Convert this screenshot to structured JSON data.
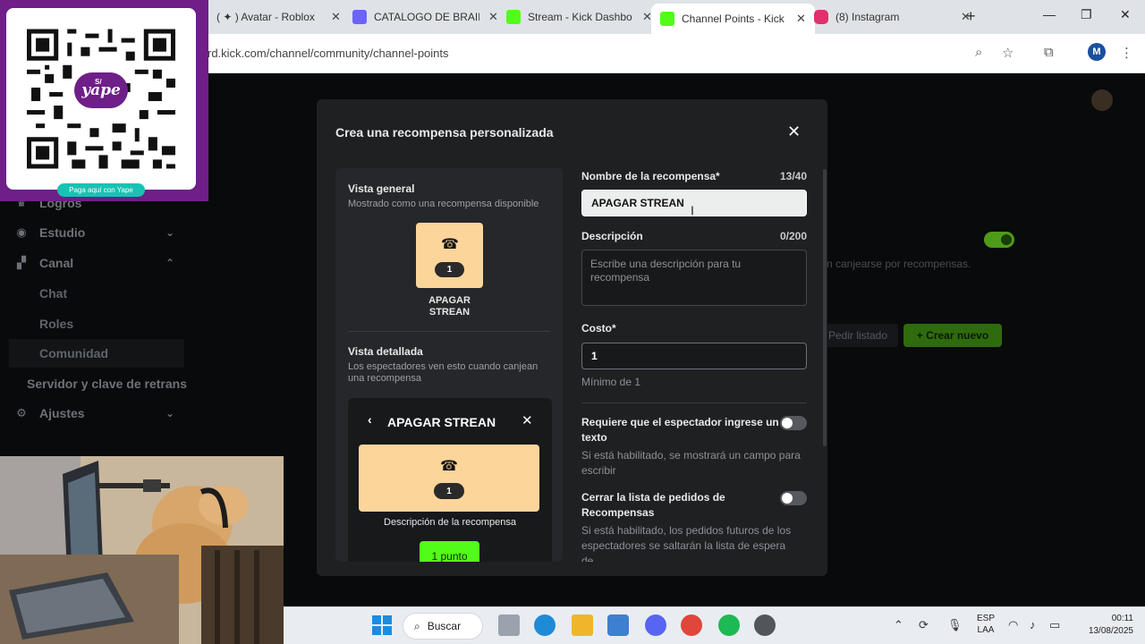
{
  "browser": {
    "tabs": [
      {
        "title": "( ✦ ) Avatar - Roblox",
        "color": "#dfe3e8",
        "favicon_color": "#dfe3e8"
      },
      {
        "title": "CATALOGO DE BRAIN",
        "favicon_color": "#6c63ff"
      },
      {
        "title": "Stream - Kick Dashbo",
        "favicon_color": "#53fc18"
      },
      {
        "title": "Channel Points - Kick",
        "favicon_color": "#53fc18",
        "active": true
      },
      {
        "title": "(8) Instagram",
        "favicon_color": "#e1306c"
      }
    ],
    "url": "rd.kick.com/channel/community/channel-points",
    "profile_initial": "M",
    "tab_close_glyph": "✕",
    "new_tab_glyph": "+"
  },
  "sidebar": {
    "items": [
      {
        "label": "Logros",
        "icon": "trophy-icon"
      },
      {
        "label": "Estudio",
        "icon": "studio-icon",
        "expandable": true
      },
      {
        "label": "Canal",
        "icon": "channel-icon",
        "expandable": true,
        "expanded": true
      },
      {
        "label": "Servidor y clave de retrans"
      },
      {
        "label": "Ajustes",
        "icon": "gear-icon",
        "expandable": true
      }
    ],
    "subitems": [
      "Chat",
      "Roles",
      "Comunidad"
    ],
    "selected_subitem": "Comunidad"
  },
  "background": {
    "text": "n canjearse por recompensas.",
    "buttons": {
      "secondary": "Pedir listado",
      "primary": "+ Crear nuevo"
    }
  },
  "modal": {
    "title": "Crea una recompensa personalizada",
    "close_glyph": "✕",
    "preview": {
      "general_title": "Vista general",
      "general_subtitle": "Mostrado como una recompensa disponible",
      "reward_cost": "1",
      "reward_name": "APAGAR STREAN",
      "detail_title": "Vista detallada",
      "detail_subtitle": "Los espectadores ven esto cuando canjean una recompensa",
      "detail_reward_name": "APAGAR STREAN",
      "detail_description": "Descripción de la recompensa",
      "redeem_button": "1 punto"
    },
    "form": {
      "name_label": "Nombre de la recompensa*",
      "name_count": "13/40",
      "name_value": "APAGAR STREAN",
      "description_label": "Descripción",
      "description_count": "0/200",
      "description_placeholder": "Escribe una descripción para tu recompensa",
      "cost_label": "Costo*",
      "cost_value": "1",
      "cost_hint": "Mínimo de 1",
      "require_text_label": "Requiere que el espectador ingrese un texto",
      "require_text_hint": "Si está habilitado, se mostrará un campo para escribir",
      "close_queue_label": "Cerrar la lista de pedidos de Recompensas",
      "close_queue_hint": "Si está habilitado, los pedidos futuros de los espectadores se saltarán la lista de espera de..."
    }
  },
  "qr_overlay": {
    "logo_text": "yape",
    "currency": "S/",
    "button": "Paga aquí con Yape"
  },
  "taskbar": {
    "search_label": "Buscar",
    "language_line1": "ESP",
    "language_line2": "LAA",
    "time": "00:11",
    "date": "13/08/2025"
  },
  "colors": {
    "kick_green": "#53fc18",
    "reward_card": "#fcd59a",
    "modal_bg": "#1e2022",
    "yape_purple": "#6e1f88"
  }
}
